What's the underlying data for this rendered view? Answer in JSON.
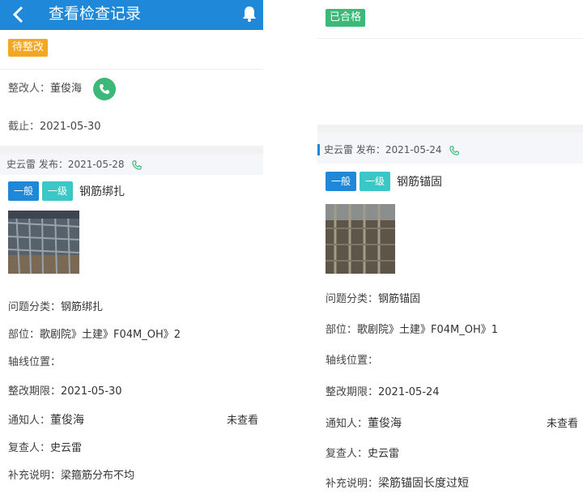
{
  "left": {
    "header": {
      "title": "查看检查记录"
    },
    "status_badge": "待整改",
    "rectifier": {
      "label": "整改人：",
      "name": "董俊海"
    },
    "deadline": {
      "label": "截止：",
      "value": "2021-05-30"
    },
    "publisher": {
      "text": "史云雷 发布：2021-05-28"
    },
    "tags": [
      "一般",
      "一级"
    ],
    "tag_title": "钢筋绑扎",
    "details": {
      "category": {
        "label": "问题分类：",
        "value": "钢筋绑扎"
      },
      "location": {
        "label": "部位：",
        "value": "歌剧院》土建》F04M_OH》2"
      },
      "axis": {
        "label": "轴线位置：",
        "value": ""
      },
      "period": {
        "label": "整改期限：",
        "value": "2021-05-30"
      },
      "notify": {
        "label": "通知人：",
        "value": "董俊海",
        "status": "未查看"
      },
      "reviewer": {
        "label": "复查人：",
        "value": "史云雷"
      },
      "note": {
        "label": "补充说明：",
        "value": "梁箍筋分布不均"
      }
    }
  },
  "right": {
    "status_badge": "已合格",
    "publisher": {
      "text": "史云雷 发布：2021-05-24"
    },
    "tags": [
      "一般",
      "一级"
    ],
    "tag_title": "钢筋锚固",
    "details": {
      "category": {
        "label": "问题分类：",
        "value": "钢筋锚固"
      },
      "location": {
        "label": "部位：",
        "value": "歌剧院》土建》F04M_OH》1"
      },
      "axis": {
        "label": "轴线位置：",
        "value": ""
      },
      "period": {
        "label": "整改期限：",
        "value": "2021-05-24"
      },
      "notify": {
        "label": "通知人：",
        "value": "董俊海",
        "status": "未查看"
      },
      "reviewer": {
        "label": "复查人：",
        "value": "史云雷"
      },
      "note": {
        "label": "补充说明：",
        "value": "梁筋锚固长度过短"
      }
    }
  },
  "colors": {
    "primary": "#1f88d8",
    "green": "#3cb878",
    "orange": "#f5a623",
    "cyan": "#3cc7c7"
  }
}
